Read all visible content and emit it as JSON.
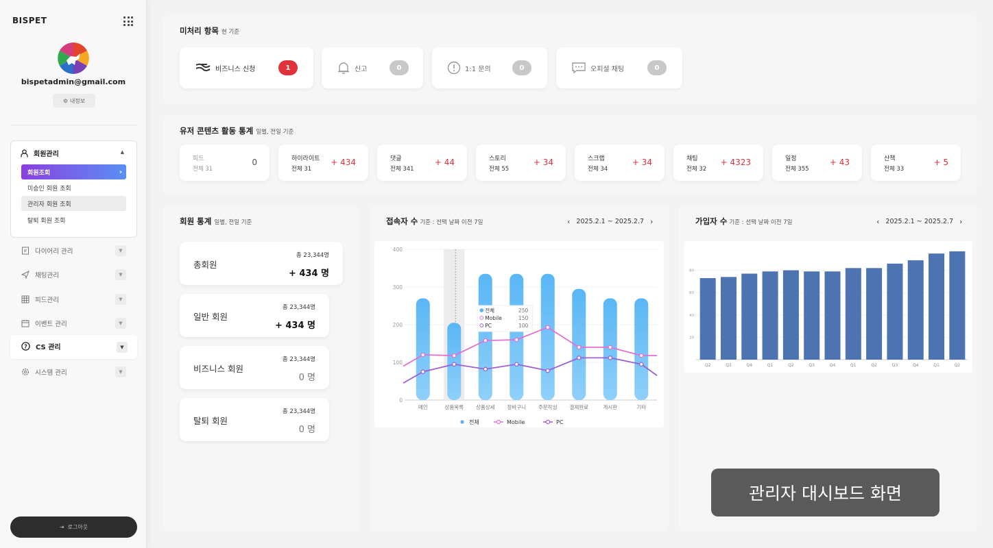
{
  "sidebar": {
    "logo": "BISPET",
    "email": "bispetadmin@gmail.com",
    "myinfo_label": "내정보",
    "member_menu": {
      "label": "회원관리",
      "items": [
        {
          "label": "회원조회"
        },
        {
          "label": "미승인 회원 조회"
        },
        {
          "label": "관리자 회원 조회"
        },
        {
          "label": "탈퇴 회원 조회"
        }
      ]
    },
    "nav": [
      {
        "label": "다이어리 관리"
      },
      {
        "label": "채팅관리"
      },
      {
        "label": "피드관리"
      },
      {
        "label": "이벤트 관리"
      }
    ],
    "cs_label": "CS 관리",
    "system_label": "시스템 관리",
    "logout_label": "로그아웃"
  },
  "todo": {
    "title": "미처리 항목",
    "subtitle": "현 기준",
    "items": [
      {
        "label": "비즈니스 신청",
        "count": "1",
        "icon": "business-icon"
      },
      {
        "label": "신고",
        "count": "0",
        "icon": "bell-icon"
      },
      {
        "label": "1:1 문의",
        "count": "0",
        "icon": "alert-icon"
      },
      {
        "label": "오피셜 채팅",
        "count": "0",
        "icon": "chat-icon"
      }
    ]
  },
  "content_stats": {
    "title": "유저 콘텐츠 활동 통계",
    "subtitle": "일별, 전일 기준",
    "items": [
      {
        "name": "피드",
        "total": "전체 31",
        "inc": "0"
      },
      {
        "name": "하이라이트",
        "total": "전체 31",
        "inc": "+ 434"
      },
      {
        "name": "댓글",
        "total": "전체 341",
        "inc": "+ 44"
      },
      {
        "name": "스토리",
        "total": "전체 55",
        "inc": "+ 34"
      },
      {
        "name": "스크랩",
        "total": "전체 34",
        "inc": "+ 34"
      },
      {
        "name": "채팅",
        "total": "전체 32",
        "inc": "+ 4323"
      },
      {
        "name": "일정",
        "total": "전체 355",
        "inc": "+ 43"
      },
      {
        "name": "산책",
        "total": "전체 33",
        "inc": "+ 5"
      }
    ]
  },
  "member_stats": {
    "title": "회원 통계",
    "subtitle": "일별, 전일 기준",
    "items": [
      {
        "name": "총회원",
        "total": "총 23,344명",
        "inc": "+ 434 명"
      },
      {
        "name": "일반 회원",
        "total": "총 23,344명",
        "inc": "+ 434 명"
      },
      {
        "name": "비즈니스 회원",
        "total": "총 23,344명",
        "inc": "0 명"
      },
      {
        "name": "탈퇴 회원",
        "total": "총 23,344명",
        "inc": "0 명"
      }
    ]
  },
  "visitors": {
    "title": "접속자 수",
    "subtitle": "기준 : 선택 날짜 이전 7일",
    "date_range": "2025.2.1 ~ 2025.2.7"
  },
  "signups": {
    "title": "가입자 수",
    "subtitle": "기준 : 선택 날짜 이전 7일",
    "date_range": "2025.2.1 ~ 2025.2.7"
  },
  "caption": "관리자 대시보드 화면",
  "chart_data": [
    {
      "type": "bar",
      "categories": [
        "메인",
        "상품목록",
        "상품상세",
        "장바구니",
        "주문작성",
        "결제완료",
        "게시판",
        "기타"
      ],
      "ylim": [
        0,
        400
      ],
      "yticks": [
        0,
        100,
        200,
        300,
        400
      ],
      "series": [
        {
          "name": "전체",
          "type": "bar",
          "color": "#5cb3f2",
          "values": [
            270,
            205,
            335,
            335,
            335,
            295,
            270,
            270
          ]
        },
        {
          "name": "Mobile",
          "type": "line",
          "color": "#e46fd0",
          "values": [
            120,
            118,
            158,
            160,
            193,
            140,
            140,
            118
          ]
        },
        {
          "name": "PC",
          "type": "line",
          "color": "#9b5fd6",
          "values": [
            75,
            95,
            82,
            95,
            78,
            112,
            112,
            95
          ]
        }
      ],
      "tooltip": {
        "rows": [
          {
            "name": "전체",
            "value": "250"
          },
          {
            "name": "Mobile",
            "value": "150"
          },
          {
            "name": "PC",
            "value": "100"
          }
        ]
      },
      "highlight_index": 1,
      "legend": "bottom"
    },
    {
      "type": "bar",
      "categories": [
        "Q2",
        "Q3",
        "Q4",
        "Q1",
        "Q2",
        "Q3",
        "Q4",
        "Q1",
        "Q2",
        "Q3",
        "Q4",
        "Q1",
        "Q2"
      ],
      "ylim": [
        0,
        100
      ],
      "yticks": [
        20,
        40,
        60,
        80
      ],
      "color": "#4d73b1",
      "values": [
        73,
        74,
        77,
        79,
        80,
        79,
        79,
        82,
        82,
        86,
        89,
        95,
        97
      ]
    }
  ]
}
